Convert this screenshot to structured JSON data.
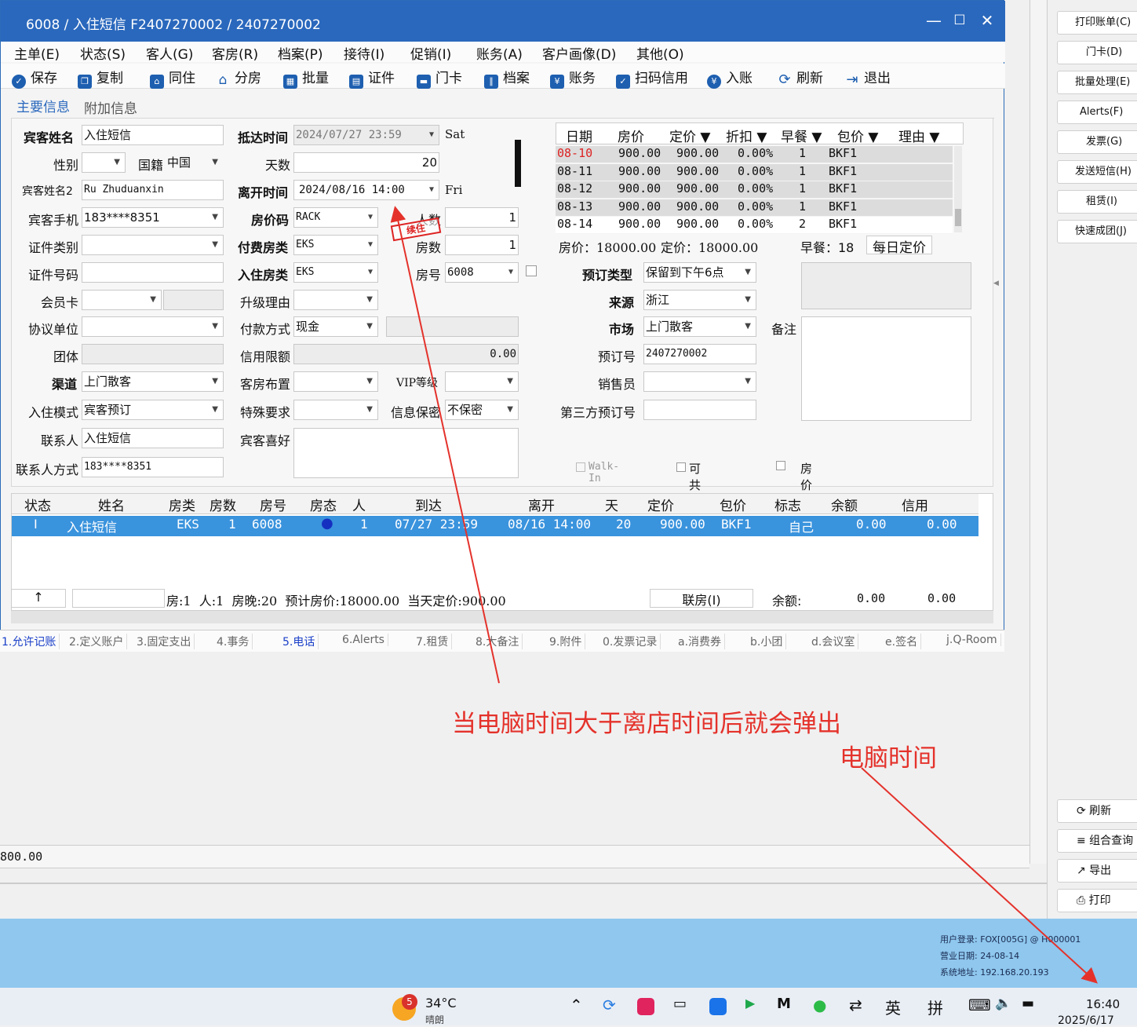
{
  "window": {
    "title": "6008 / 入住短信 F2407270002 / 2407270002",
    "min": "—",
    "max": "☐",
    "close": "✕"
  },
  "menu": [
    "主单(E)",
    "状态(S)",
    "客人(G)",
    "客房(R)",
    "档案(P)",
    "接待(I)",
    "促销(I)",
    "账务(A)",
    "客户画像(D)",
    "其他(O)"
  ],
  "toolbar": [
    "保存",
    "复制",
    "同住",
    "分房",
    "批量",
    "证件",
    "门卡",
    "档案",
    "账务",
    "扫码信用",
    "入账",
    "刷新",
    "退出"
  ],
  "tabs_top": [
    "主要信息",
    "附加信息"
  ],
  "form": {
    "guest_name_label": "宾客姓名",
    "guest_name": "入住短信",
    "gender_label": "性别",
    "gender": "",
    "nationality_label": "国籍",
    "nationality": "中国",
    "guest_name2_label": "宾客姓名2",
    "guest_name2": "Ru Zhuduanxin",
    "phone_label": "宾客手机",
    "phone": "183****8351",
    "id_type_label": "证件类别",
    "id_type": "",
    "id_no_label": "证件号码",
    "id_no": "",
    "member_label": "会员卡",
    "member": "",
    "agreement_label": "协议单位",
    "agreement": "",
    "group_label": "团体",
    "group": "",
    "channel_label": "渠道",
    "channel": "上门散客",
    "checkin_mode_label": "入住模式",
    "checkin_mode": "宾客预订",
    "contact_label": "联系人",
    "contact": "入住短信",
    "contact_method_label": "联系人方式",
    "contact_method": "183****8351",
    "arrive_label": "抵达时间",
    "arrive": "2024/07/27 23:59",
    "arrive_day": "Sat",
    "days_label": "天数",
    "days": "20",
    "depart_label": "离开时间",
    "depart": "2024/08/16 14:00",
    "depart_day": "Fri",
    "rate_code_label": "房价码",
    "rate_code": "RACK",
    "pay_room_label": "付费房类",
    "pay_room": "EKS",
    "checkin_room_label": "入住房类",
    "checkin_room": "EKS",
    "upgrade_label": "升级理由",
    "upgrade": "",
    "pay_method_label": "付款方式",
    "pay_method": "现金",
    "credit_label": "信用限额",
    "credit": "0.00",
    "layout_label": "客房布置",
    "layout": "",
    "special_label": "特殊要求",
    "special": "",
    "pref_label": "宾客喜好",
    "pref": "",
    "persons_label": "人数",
    "persons": "1",
    "rooms_label": "房数",
    "rooms": "1",
    "room_no_label": "房号",
    "room_no": "6008",
    "vip_label": "VIP等级",
    "vip": "",
    "privacy_label": "信息保密",
    "privacy": "不保密",
    "stamp": "续住",
    "book_type_label": "预订类型",
    "book_type": "保留到下午6点",
    "source_label": "来源",
    "source": "浙江",
    "market_label": "市场",
    "market": "上门散客",
    "book_no_label": "预订号",
    "book_no": "2407270002",
    "sales_label": "销售员",
    "sales": "",
    "third_label": "第三方预订号",
    "third": "",
    "remark_label": "备注",
    "walkin": "Walk-In",
    "shareable": "可共享",
    "rate_secret": "房价保密"
  },
  "price_grid": {
    "headers": [
      "日期",
      "房价",
      "定价 ▼",
      "折扣 ▼",
      "早餐 ▼",
      "包价 ▼",
      "理由 ▼"
    ],
    "rows": [
      {
        "date": "08-10",
        "rate": "900.00",
        "price": "900.00",
        "disc": "0.00%",
        "bkf": "1",
        "pkg": "BKF1",
        "reason": ""
      },
      {
        "date": "08-11",
        "rate": "900.00",
        "price": "900.00",
        "disc": "0.00%",
        "bkf": "1",
        "pkg": "BKF1",
        "reason": ""
      },
      {
        "date": "08-12",
        "rate": "900.00",
        "price": "900.00",
        "disc": "0.00%",
        "bkf": "1",
        "pkg": "BKF1",
        "reason": ""
      },
      {
        "date": "08-13",
        "rate": "900.00",
        "price": "900.00",
        "disc": "0.00%",
        "bkf": "1",
        "pkg": "BKF1",
        "reason": ""
      },
      {
        "date": "08-14",
        "rate": "900.00",
        "price": "900.00",
        "disc": "0.00%",
        "bkf": "2",
        "pkg": "BKF1",
        "reason": ""
      }
    ],
    "summary_rate": "房价：18000.00",
    "summary_price": "定价：18000.00",
    "summary_bkf": "早餐：18",
    "daily_btn": "每日定价"
  },
  "grid": {
    "headers": [
      "状态",
      "姓名",
      "房类",
      "房数",
      "房号",
      "房态",
      "人",
      "到达",
      "离开",
      "天",
      "定价",
      "包价",
      "标志",
      "余额",
      "信用"
    ],
    "row": {
      "status": "I",
      "name": "入住短信",
      "type": "EKS",
      "rooms": "1",
      "no": "6008",
      "state": "●",
      "persons": "1",
      "arrive": "07/27 23:59",
      "depart": "08/16 14:00",
      "days": "20",
      "price": "900.00",
      "pkg": "BKF1",
      "flag": "自己",
      "balance": "0.00",
      "credit": "0.00"
    },
    "footer": {
      "up": "↑",
      "stats": "房:1  人:1  房晚:20  预计房价:18000.00  当天定价:900.00",
      "link": "联房(I)",
      "balance_label": "余额:",
      "balance": "0.00",
      "credit": "0.00"
    }
  },
  "bottom_tabs": [
    "1.允许记账",
    "2.定义账户",
    "3.固定支出",
    "4.事务",
    "5.电话",
    "6.Alerts",
    "7.租赁",
    "8.大备注",
    "9.附件",
    "0.发票记录",
    "a.消费券",
    "b.小团",
    "d.会议室",
    "e.签名",
    "j.Q-Room"
  ],
  "right_buttons": [
    "打印账单(C)",
    "门卡(D)",
    "批量处理(E)",
    "Alerts(F)",
    "发票(G)",
    "发送短信(H)",
    "租赁(I)",
    "快速成团(J)"
  ],
  "right_bottom": [
    "⟳ 刷新",
    "≡ 组合查询",
    "↗ 导出",
    "⎙ 打印"
  ],
  "bg_value": "800.00",
  "info": {
    "user": "用户登录:  FOX[005G] @ H000001",
    "date": "营业日期:  24-08-14",
    "ip": "系统地址:  192.168.20.193"
  },
  "taskbar": {
    "badge": "5",
    "temp": "34°C",
    "weather": "晴朗",
    "ime1": "英",
    "ime2": "拼",
    "time": "16:40",
    "date": "2025/6/17"
  },
  "annotation": {
    "main": "当电脑时间大于离店时间后就会弹出",
    "sub": "电脑时间"
  }
}
